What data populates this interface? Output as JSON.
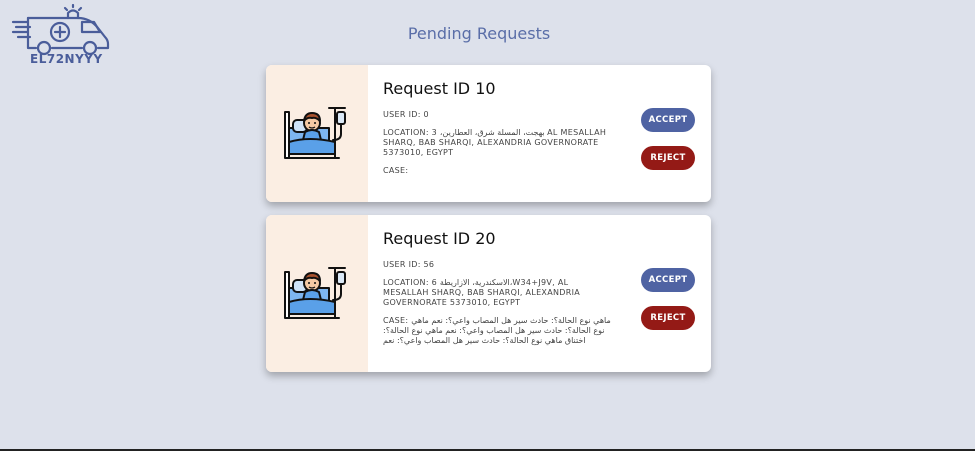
{
  "app": {
    "logo_text": "EL72NYYY",
    "page_title": "Pending Requests"
  },
  "requests": [
    {
      "title": "Request ID 10",
      "user_id": "USER ID: 0",
      "location": "LOCATION: 3 ،بهجت، المسلة شرق، العطارين AL MESALLAH SHARQ, BAB SHARQI, ALEXANDRIA GOVERNORATE 5373010, EGYPT",
      "case": "CASE:",
      "accept_label": "ACCEPT",
      "reject_label": "REJECT"
    },
    {
      "title": "Request ID 20",
      "user_id": "USER ID: 56",
      "location": "LOCATION: 6 الاسكندرية، الازاريطة،W34+J9V, AL MESALLAH SHARQ, BAB SHARQI, ALEXANDRIA GOVERNORATE 5373010, EGYPT",
      "case": "CASE: ماهي نوع الحالة؟: حادث سير هل المصاب واعي؟: نعم ماهي نوع الحالة؟: حادث سير هل المصاب واعي؟: نعم ماهي نوع الحالة؟: اختناق ماهي نوع الحالة؟: حادث سير هل المصاب واعي؟: نعم",
      "accept_label": "ACCEPT",
      "reject_label": "REJECT"
    }
  ],
  "icons": {
    "logo": "ambulance-icon",
    "patient": "patient-in-bed-icon"
  },
  "colors": {
    "background": "#dde1eb",
    "accent": "#4f63a3",
    "reject": "#941a16",
    "card_side": "#fbeee3"
  }
}
